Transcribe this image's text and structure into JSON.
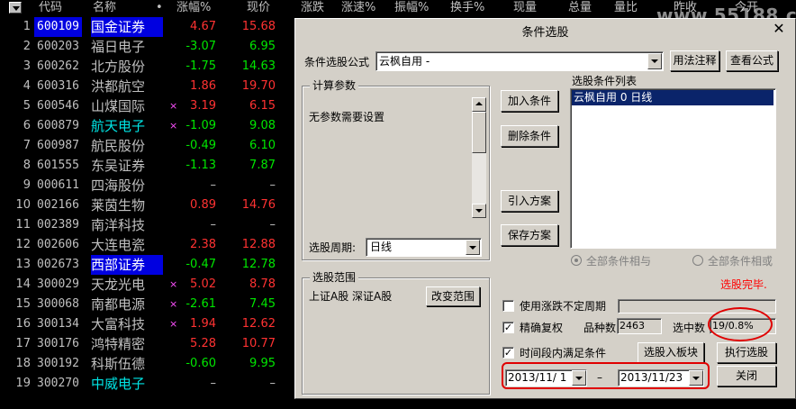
{
  "watermark": "www.55188.com",
  "table": {
    "headers": [
      "代码",
      "名称",
      "•",
      "涨幅%",
      "现价",
      "涨跌",
      "涨速%",
      "振幅%",
      "换手%",
      "现量",
      "总量",
      "量比",
      "昨收",
      "今开"
    ],
    "rows": [
      {
        "idx": "1",
        "code": "600109",
        "name": "国金证券",
        "mark": "",
        "chg": "4.67",
        "price": "15.68",
        "dir": "up",
        "selected": true,
        "cyan": false
      },
      {
        "idx": "2",
        "code": "600203",
        "name": "福日电子",
        "mark": "",
        "chg": "-3.07",
        "price": "6.95",
        "dir": "down",
        "selected": false,
        "cyan": false
      },
      {
        "idx": "3",
        "code": "600262",
        "name": "北方股份",
        "mark": "",
        "chg": "-1.75",
        "price": "14.63",
        "dir": "down",
        "selected": false,
        "cyan": false
      },
      {
        "idx": "4",
        "code": "600316",
        "name": "洪都航空",
        "mark": "",
        "chg": "1.86",
        "price": "19.70",
        "dir": "up",
        "selected": false,
        "cyan": false
      },
      {
        "idx": "5",
        "code": "600546",
        "name": "山煤国际",
        "mark": "×",
        "chg": "3.19",
        "price": "6.15",
        "dir": "up",
        "selected": false,
        "cyan": false
      },
      {
        "idx": "6",
        "code": "600879",
        "name": "航天电子",
        "mark": "×",
        "chg": "-1.09",
        "price": "9.08",
        "dir": "down",
        "selected": false,
        "cyan": true
      },
      {
        "idx": "7",
        "code": "600987",
        "name": "航民股份",
        "mark": "",
        "chg": "-0.49",
        "price": "6.10",
        "dir": "down",
        "selected": false,
        "cyan": false
      },
      {
        "idx": "8",
        "code": "601555",
        "name": "东吴证券",
        "mark": "",
        "chg": "-1.13",
        "price": "7.87",
        "dir": "down",
        "selected": false,
        "cyan": false
      },
      {
        "idx": "9",
        "code": "000611",
        "name": "四海股份",
        "mark": "",
        "chg": "–",
        "price": "–",
        "dir": "flat",
        "selected": false,
        "cyan": false
      },
      {
        "idx": "10",
        "code": "002166",
        "name": "莱茵生物",
        "mark": "",
        "chg": "0.89",
        "price": "14.76",
        "dir": "up",
        "selected": false,
        "cyan": false
      },
      {
        "idx": "11",
        "code": "002389",
        "name": "南洋科技",
        "mark": "",
        "chg": "–",
        "price": "–",
        "dir": "flat",
        "selected": false,
        "cyan": false
      },
      {
        "idx": "12",
        "code": "002606",
        "name": "大连电瓷",
        "mark": "",
        "chg": "2.38",
        "price": "12.88",
        "dir": "up",
        "selected": false,
        "cyan": false
      },
      {
        "idx": "13",
        "code": "002673",
        "name": "西部证券",
        "mark": "",
        "chg": "-0.47",
        "price": "12.78",
        "dir": "down",
        "selected": false,
        "cyan": false,
        "namebox": true
      },
      {
        "idx": "14",
        "code": "300029",
        "name": "天龙光电",
        "mark": "×",
        "chg": "5.02",
        "price": "8.78",
        "dir": "up",
        "selected": false,
        "cyan": false
      },
      {
        "idx": "15",
        "code": "300068",
        "name": "南都电源",
        "mark": "×",
        "chg": "-2.61",
        "price": "7.45",
        "dir": "down",
        "selected": false,
        "cyan": false
      },
      {
        "idx": "16",
        "code": "300134",
        "name": "大富科技",
        "mark": "×",
        "chg": "1.94",
        "price": "12.62",
        "dir": "up",
        "selected": false,
        "cyan": false
      },
      {
        "idx": "17",
        "code": "300176",
        "name": "鸿特精密",
        "mark": "",
        "chg": "5.28",
        "price": "10.77",
        "dir": "up",
        "selected": false,
        "cyan": false
      },
      {
        "idx": "18",
        "code": "300192",
        "name": "科斯伍德",
        "mark": "",
        "chg": "-0.60",
        "price": "9.95",
        "dir": "down",
        "selected": false,
        "cyan": false
      },
      {
        "idx": "19",
        "code": "300270",
        "name": "中威电子",
        "mark": "",
        "chg": "–",
        "price": "–",
        "dir": "flat",
        "selected": false,
        "cyan": true
      }
    ]
  },
  "dialog": {
    "title": "条件选股",
    "close": "✕",
    "formula_label": "条件选股公式",
    "formula_value": "云枫自用 -",
    "usage_button": "用法注释",
    "view_formula_button": "查看公式",
    "params_group": "计算参数",
    "params_text": "无参数需要设置",
    "period_label": "选股周期:",
    "period_value": "日线",
    "add_condition": "加入条件",
    "delete_condition": "删除条件",
    "import_plan": "引入方案",
    "save_plan": "保存方案",
    "condition_list_title": "选股条件列表",
    "conditions": [
      "云枫自用  0 日线"
    ],
    "radio_and": "全部条件相与",
    "radio_or": "全部条件相或",
    "status": "选股完毕.",
    "scope_group": "选股范围",
    "scope_text": "上证A股 深证A股",
    "change_scope": "改变范围",
    "use_float_period": "使用涨跌不定周期",
    "precise_adjust": "精确复权",
    "count_label": "品种数",
    "count_value": "2463",
    "selected_label": "选中数",
    "selected_value": "19/0.8%",
    "time_condition": "时间段内满足条件",
    "to_block": "选股入板块",
    "execute": "执行选股",
    "start_date": "2013/11/ 1",
    "dash": "–",
    "end_date": "2013/11/23",
    "close_button": "关闭",
    "check_mark": "✓"
  },
  "colors": {
    "up": "#ff3232",
    "down": "#00e600",
    "selection": "#0000e0",
    "cyan": "#00e5e5",
    "annotation": "#e00000",
    "status_red": "#ff0000"
  }
}
